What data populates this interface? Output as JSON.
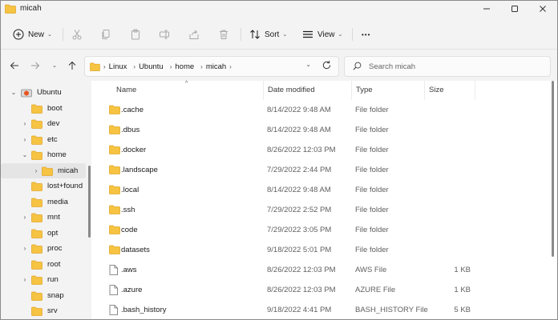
{
  "window": {
    "title": "micah"
  },
  "colors": {
    "folder": "#f6c342",
    "folder_dark": "#e2a82a",
    "accent": "#0067c0",
    "ubuntu": "#e95420"
  },
  "toolbar": {
    "new_label": "New",
    "sort_label": "Sort",
    "view_label": "View",
    "more_label": "•••"
  },
  "address": {
    "crumbs": [
      "Linux",
      "Ubuntu",
      "home",
      "micah"
    ]
  },
  "search": {
    "placeholder": "Search micah"
  },
  "sidebar": {
    "items": [
      {
        "label": "Ubuntu",
        "expander": "⌄",
        "icon": "ubuntu-drive-icon",
        "selected": false
      },
      {
        "label": "boot",
        "expander": "",
        "icon": "folder-icon",
        "selected": false
      },
      {
        "label": "dev",
        "expander": "›",
        "icon": "folder-icon",
        "selected": false
      },
      {
        "label": "etc",
        "expander": "›",
        "icon": "folder-icon",
        "selected": false
      },
      {
        "label": "home",
        "expander": "⌄",
        "icon": "folder-icon",
        "selected": false
      },
      {
        "label": "micah",
        "expander": "›",
        "icon": "folder-icon",
        "selected": true
      },
      {
        "label": "lost+found",
        "expander": "",
        "icon": "folder-icon",
        "selected": false
      },
      {
        "label": "media",
        "expander": "",
        "icon": "folder-icon",
        "selected": false
      },
      {
        "label": "mnt",
        "expander": "›",
        "icon": "folder-icon",
        "selected": false
      },
      {
        "label": "opt",
        "expander": "",
        "icon": "folder-icon",
        "selected": false
      },
      {
        "label": "proc",
        "expander": "›",
        "icon": "folder-icon",
        "selected": false
      },
      {
        "label": "root",
        "expander": "",
        "icon": "folder-icon",
        "selected": false
      },
      {
        "label": "run",
        "expander": "›",
        "icon": "folder-icon",
        "selected": false
      },
      {
        "label": "snap",
        "expander": "",
        "icon": "folder-icon",
        "selected": false
      },
      {
        "label": "srv",
        "expander": "",
        "icon": "folder-icon",
        "selected": false
      }
    ]
  },
  "table": {
    "columns": {
      "name": "Name",
      "date": "Date modified",
      "type": "Type",
      "size": "Size"
    },
    "rows": [
      {
        "name": ".cache",
        "date": "8/14/2022 9:48 AM",
        "type": "File folder",
        "size": "",
        "icon": "folder-icon"
      },
      {
        "name": ".dbus",
        "date": "8/14/2022 9:48 AM",
        "type": "File folder",
        "size": "",
        "icon": "folder-icon"
      },
      {
        "name": ".docker",
        "date": "8/26/2022 12:03 PM",
        "type": "File folder",
        "size": "",
        "icon": "folder-icon"
      },
      {
        "name": ".landscape",
        "date": "7/29/2022 2:44 PM",
        "type": "File folder",
        "size": "",
        "icon": "folder-icon"
      },
      {
        "name": ".local",
        "date": "8/14/2022 9:48 AM",
        "type": "File folder",
        "size": "",
        "icon": "folder-icon"
      },
      {
        "name": ".ssh",
        "date": "7/29/2022 2:52 PM",
        "type": "File folder",
        "size": "",
        "icon": "folder-icon"
      },
      {
        "name": "code",
        "date": "7/29/2022 3:05 PM",
        "type": "File folder",
        "size": "",
        "icon": "folder-icon"
      },
      {
        "name": "datasets",
        "date": "9/18/2022 5:01 PM",
        "type": "File folder",
        "size": "",
        "icon": "folder-icon"
      },
      {
        "name": ".aws",
        "date": "8/26/2022 12:03 PM",
        "type": "AWS File",
        "size": "1 KB",
        "icon": "file-icon"
      },
      {
        "name": ".azure",
        "date": "8/26/2022 12:03 PM",
        "type": "AZURE File",
        "size": "1 KB",
        "icon": "file-icon"
      },
      {
        "name": ".bash_history",
        "date": "9/18/2022 4:41 PM",
        "type": "BASH_HISTORY File",
        "size": "5 KB",
        "icon": "file-icon"
      }
    ]
  }
}
